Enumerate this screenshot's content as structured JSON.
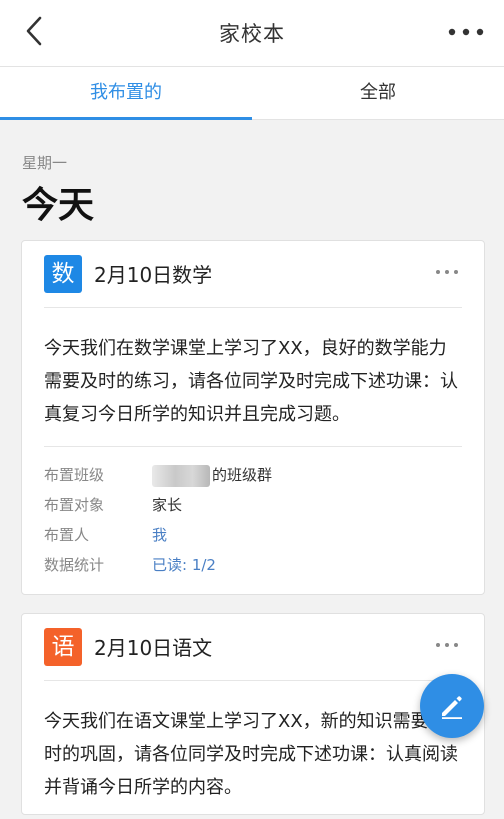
{
  "header": {
    "title": "家校本"
  },
  "tabs": [
    {
      "label": "我布置的",
      "active": true
    },
    {
      "label": "全部",
      "active": false
    }
  ],
  "day": {
    "weekday": "星期一",
    "label": "今天"
  },
  "cards": [
    {
      "badge": "数",
      "badge_color": "#1e88e5",
      "title": "2月10日数学",
      "body": "今天我们在数学课堂上学习了XX，良好的数学能力需要及时的练习，请各位同学及时完成下述功课：认真复习今日所学的知识并且完成习题。",
      "meta": {
        "class_label": "布置班级",
        "class_value": "的班级群",
        "target_label": "布置对象",
        "target_value": "家长",
        "assigner_label": "布置人",
        "assigner_value": "我",
        "stats_label": "数据统计",
        "stats_value": "已读: 1/2"
      }
    },
    {
      "badge": "语",
      "badge_color": "#f4622a",
      "title": "2月10日语文",
      "body": "今天我们在语文课堂上学习了XX，新的知识需要及时的巩固，请各位同学及时完成下述功课：认真阅读并背诵今日所学的内容。"
    }
  ],
  "colors": {
    "accent": "#2f8ee5"
  },
  "icons": {
    "back": "chevron-left-icon",
    "more": "more-dots-icon",
    "fab": "pencil-icon"
  }
}
